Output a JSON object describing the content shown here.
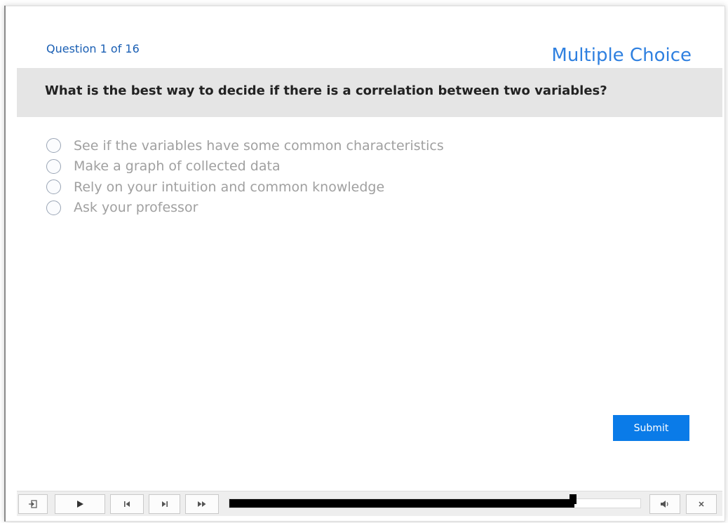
{
  "header": {
    "question_counter": "Question 1 of 16",
    "question_type": "Multiple Choice"
  },
  "question": {
    "text": "What is the best way to decide if there is a correlation between two variables?"
  },
  "options": [
    {
      "label": "See if the variables have some common characteristics",
      "selected": false
    },
    {
      "label": "Make a graph of collected data",
      "selected": false
    },
    {
      "label": "Rely on your intuition and common knowledge",
      "selected": false
    },
    {
      "label": "Ask your professor",
      "selected": false
    }
  ],
  "actions": {
    "submit_label": "Submit"
  },
  "player": {
    "icons": [
      "exit-icon",
      "play-icon",
      "skip-back-icon",
      "skip-forward-icon",
      "fast-forward-icon",
      "volume-icon",
      "close-icon"
    ],
    "progress_fraction": 0.84
  },
  "colors": {
    "accent": "#0a7be8",
    "title_blue": "#2f80e0",
    "question_bar": "#e5e5e5"
  }
}
